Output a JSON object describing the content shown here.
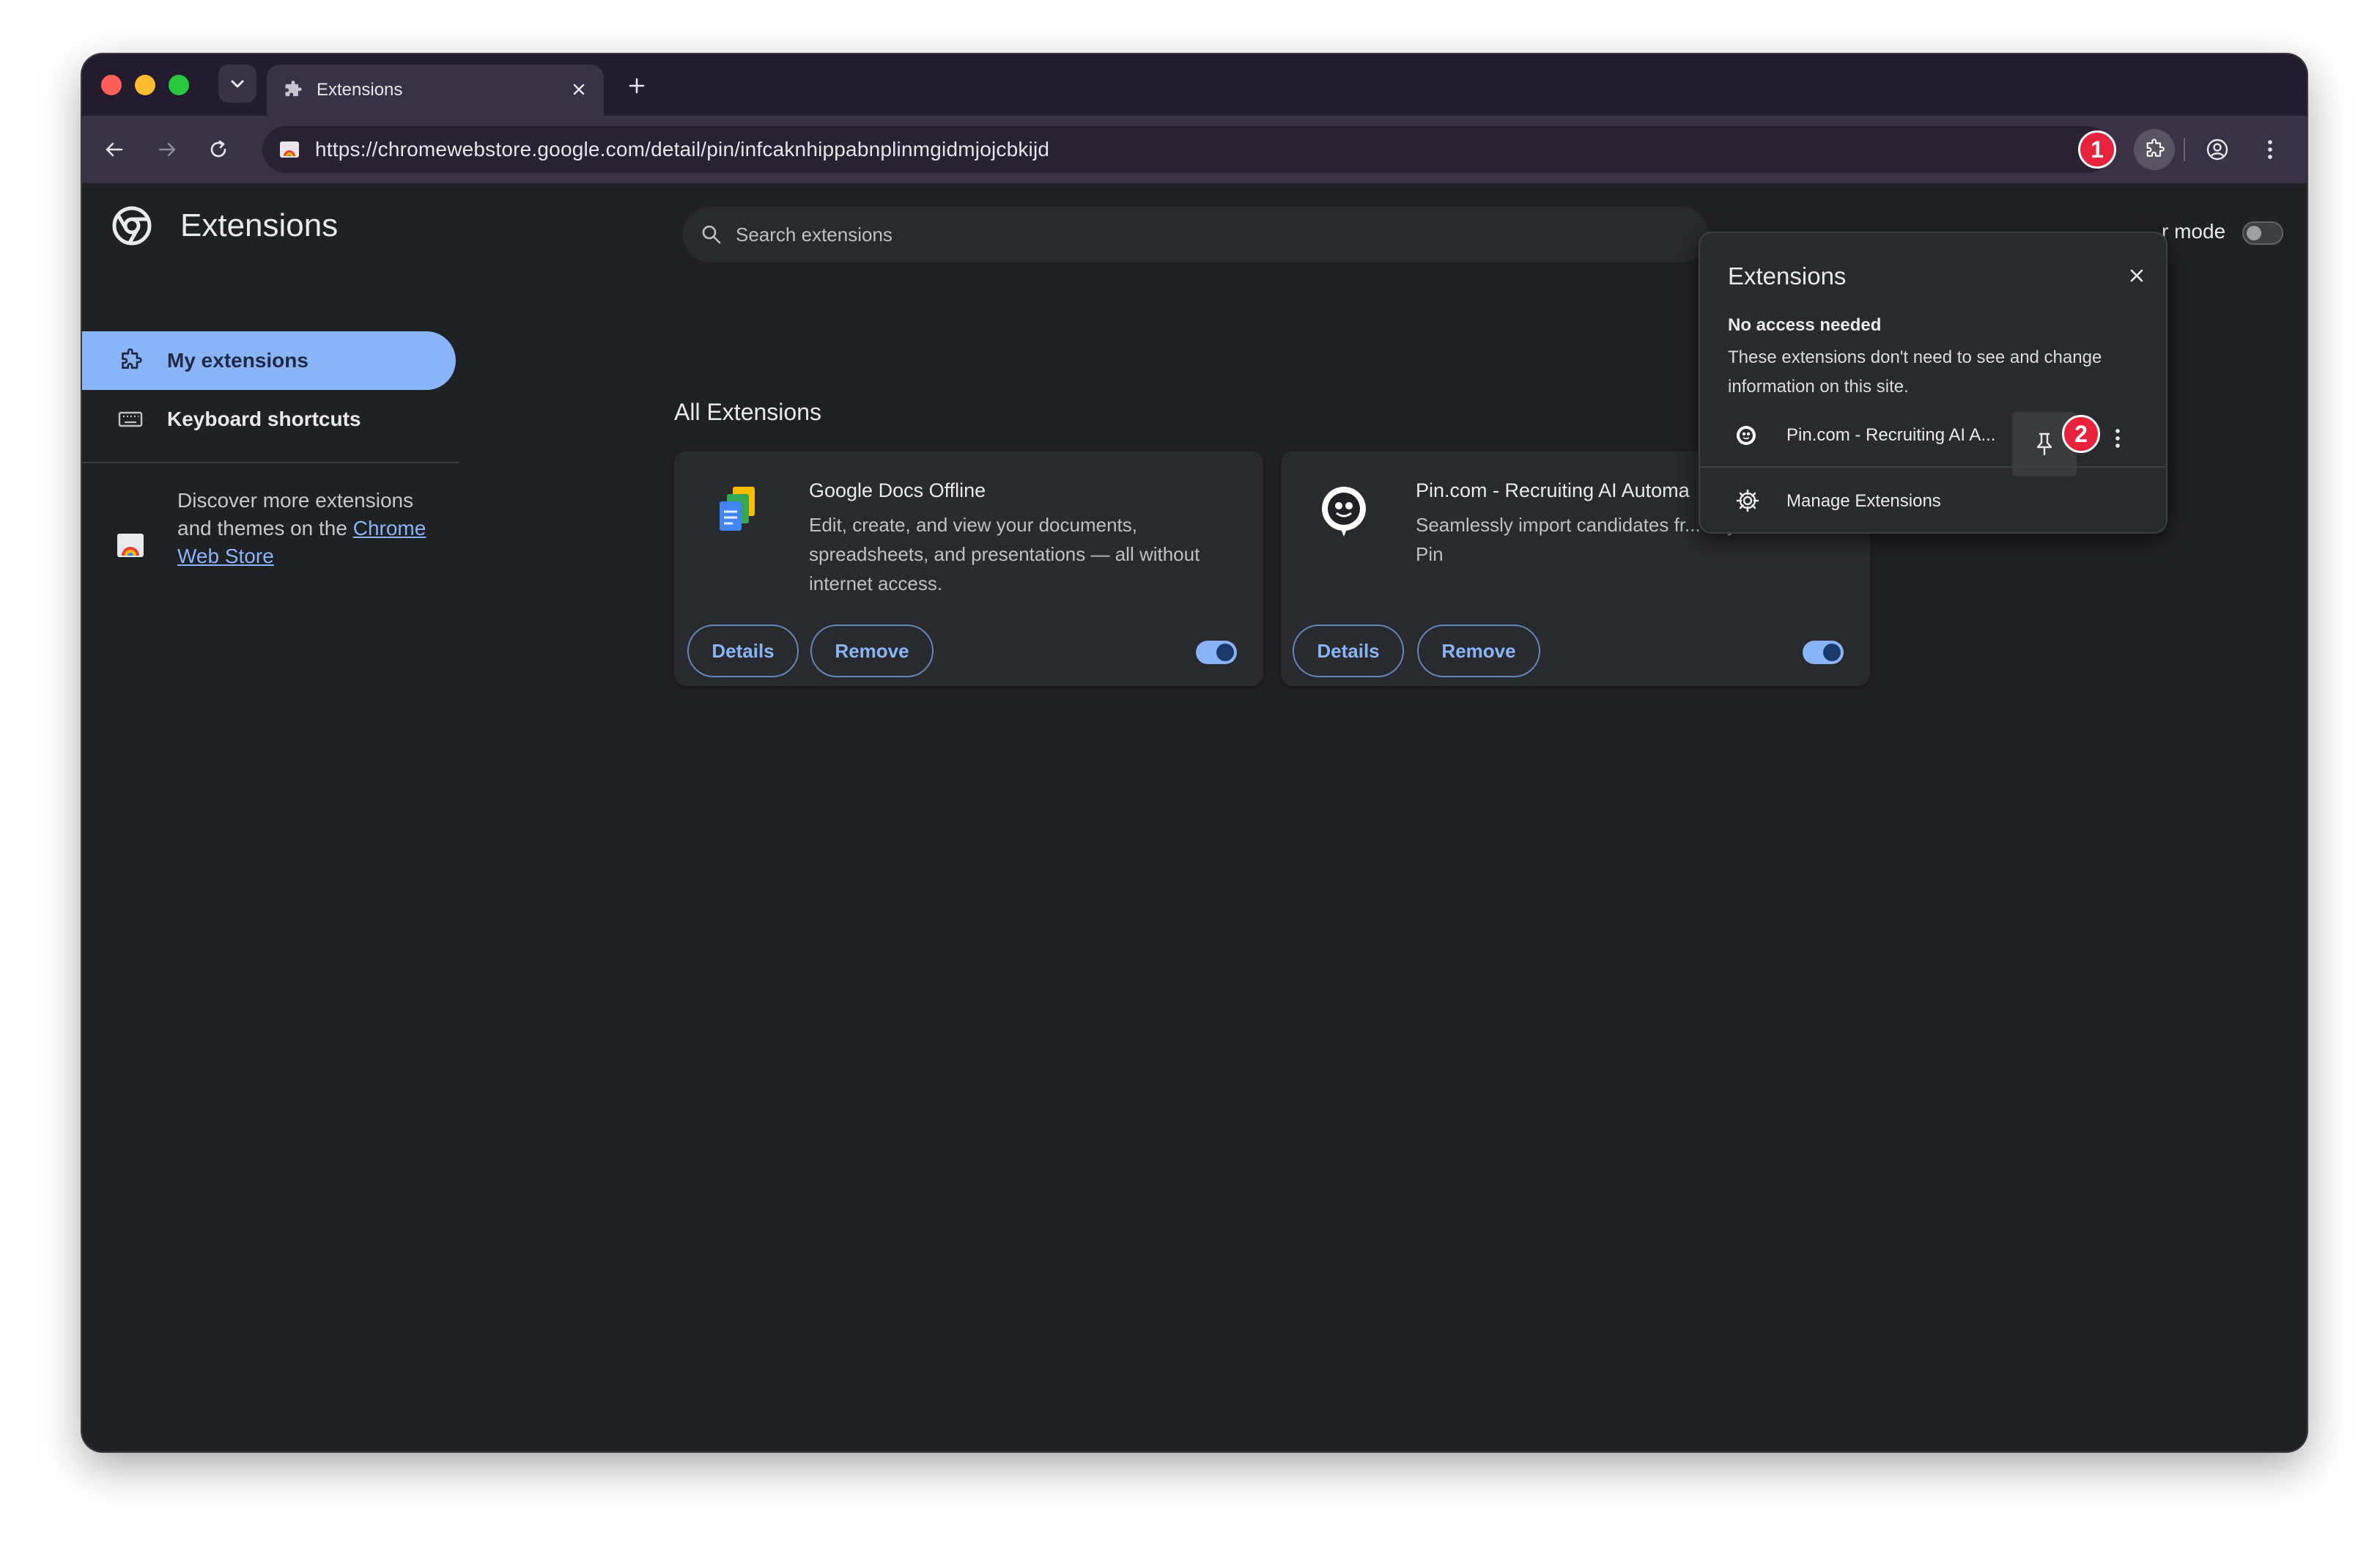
{
  "browser": {
    "tab_title": "Extensions",
    "url": "https://chromewebstore.google.com/detail/pin/infcaknhippabnplinmgidmjojcbkijd"
  },
  "annotations": {
    "badge_1": "1",
    "badge_2": "2"
  },
  "page": {
    "title": "Extensions",
    "search_placeholder": "Search extensions",
    "developer_mode_label": "r mode",
    "section_title": "All Extensions"
  },
  "sidebar": {
    "items": [
      {
        "label": "My extensions",
        "active": true
      },
      {
        "label": "Keyboard shortcuts",
        "active": false
      }
    ],
    "discover_text": "Discover more extensions and themes on the ",
    "discover_link": "Chrome Web Store"
  },
  "extensions": [
    {
      "name": "Google Docs Offline",
      "description": "Edit, create, and view your documents, spreadsheets, and presentations — all without internet access.",
      "details_label": "Details",
      "remove_label": "Remove",
      "enabled": true
    },
    {
      "name": "Pin.com - Recruiting AI Automa",
      "description": "Seamlessly import candidates fr... any website to Pin",
      "details_label": "Details",
      "remove_label": "Remove",
      "enabled": true
    }
  ],
  "popup": {
    "title": "Extensions",
    "heading": "No access needed",
    "description": "These extensions don't need to see and change information on this site.",
    "item_name": "Pin.com - Recruiting AI A...",
    "manage_label": "Manage Extensions"
  },
  "colors": {
    "accent": "#8ab4f8",
    "badge": "#e8223a",
    "frame": "#3a3144",
    "background": "#202124"
  }
}
